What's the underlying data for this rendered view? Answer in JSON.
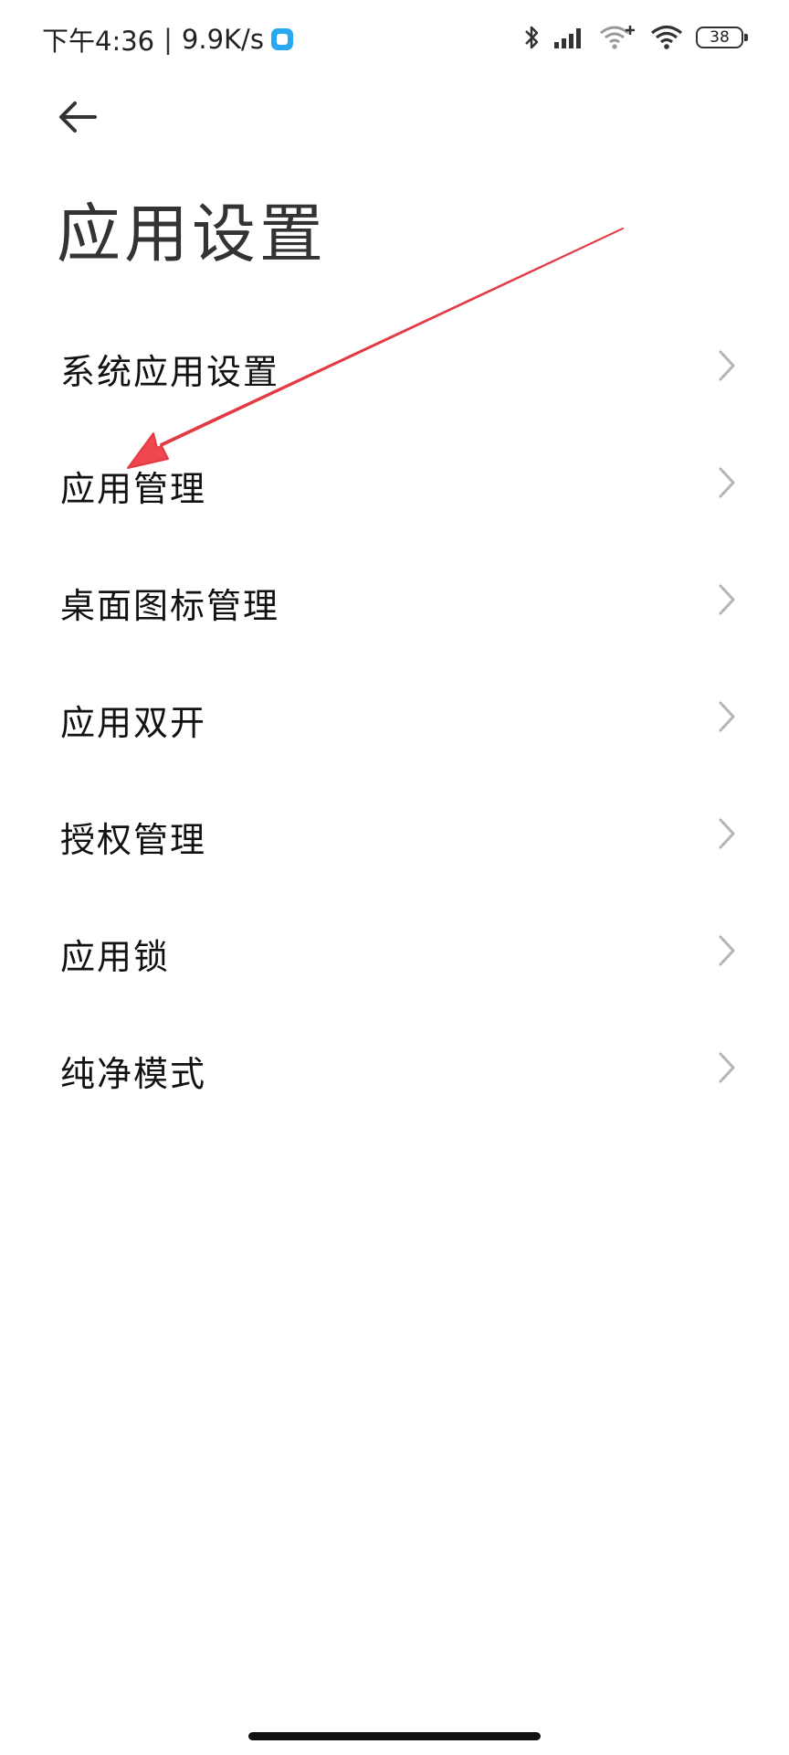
{
  "status_bar": {
    "time": "下午4:36",
    "separator": "|",
    "net_speed": "9.9K/s",
    "icons": [
      "app-notification-icon",
      "bluetooth-icon",
      "cellular-signal-icon",
      "wifi-plus-icon",
      "wifi-icon",
      "battery-icon"
    ],
    "battery": "38"
  },
  "header": {
    "back_icon": "back-arrow-icon",
    "title": "应用设置"
  },
  "menu": {
    "items": [
      {
        "label": "系统应用设置"
      },
      {
        "label": "应用管理"
      },
      {
        "label": "桌面图标管理"
      },
      {
        "label": "应用双开"
      },
      {
        "label": "授权管理"
      },
      {
        "label": "应用锁"
      },
      {
        "label": "纯净模式"
      }
    ],
    "chevron_icon": "chevron-right-icon"
  },
  "annotation": {
    "type": "arrow",
    "color": "#f0464f",
    "points_to": "应用管理"
  }
}
